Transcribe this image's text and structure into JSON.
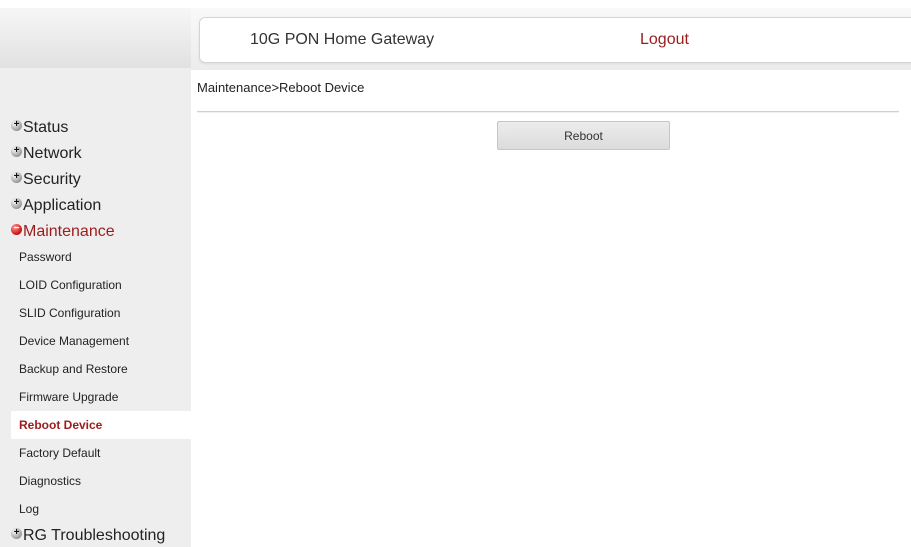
{
  "header": {
    "title": "10G PON Home Gateway",
    "logout_label": "Logout"
  },
  "breadcrumb": "Maintenance>Reboot Device",
  "main": {
    "reboot_button_label": "Reboot"
  },
  "sidebar": {
    "categories": [
      {
        "label": "Status",
        "state": "collapsed"
      },
      {
        "label": "Network",
        "state": "collapsed"
      },
      {
        "label": "Security",
        "state": "collapsed"
      },
      {
        "label": "Application",
        "state": "collapsed"
      },
      {
        "label": "Maintenance",
        "state": "expanded"
      },
      {
        "label": "RG Troubleshooting",
        "state": "collapsed"
      }
    ],
    "maintenance_items": [
      {
        "label": "Password"
      },
      {
        "label": "LOID Configuration"
      },
      {
        "label": "SLID Configuration"
      },
      {
        "label": "Device Management"
      },
      {
        "label": "Backup and Restore"
      },
      {
        "label": "Firmware Upgrade"
      },
      {
        "label": "Reboot Device",
        "active": true
      },
      {
        "label": "Factory Default"
      },
      {
        "label": "Diagnostics"
      },
      {
        "label": "Log"
      }
    ]
  },
  "colors": {
    "accent": "#9b1c1c",
    "sidebar_bg": "#eeeeee",
    "active_item_bg": "#ffffff"
  },
  "icons": {
    "collapsed": "plus-circle-icon",
    "expanded": "minus-circle-icon"
  }
}
